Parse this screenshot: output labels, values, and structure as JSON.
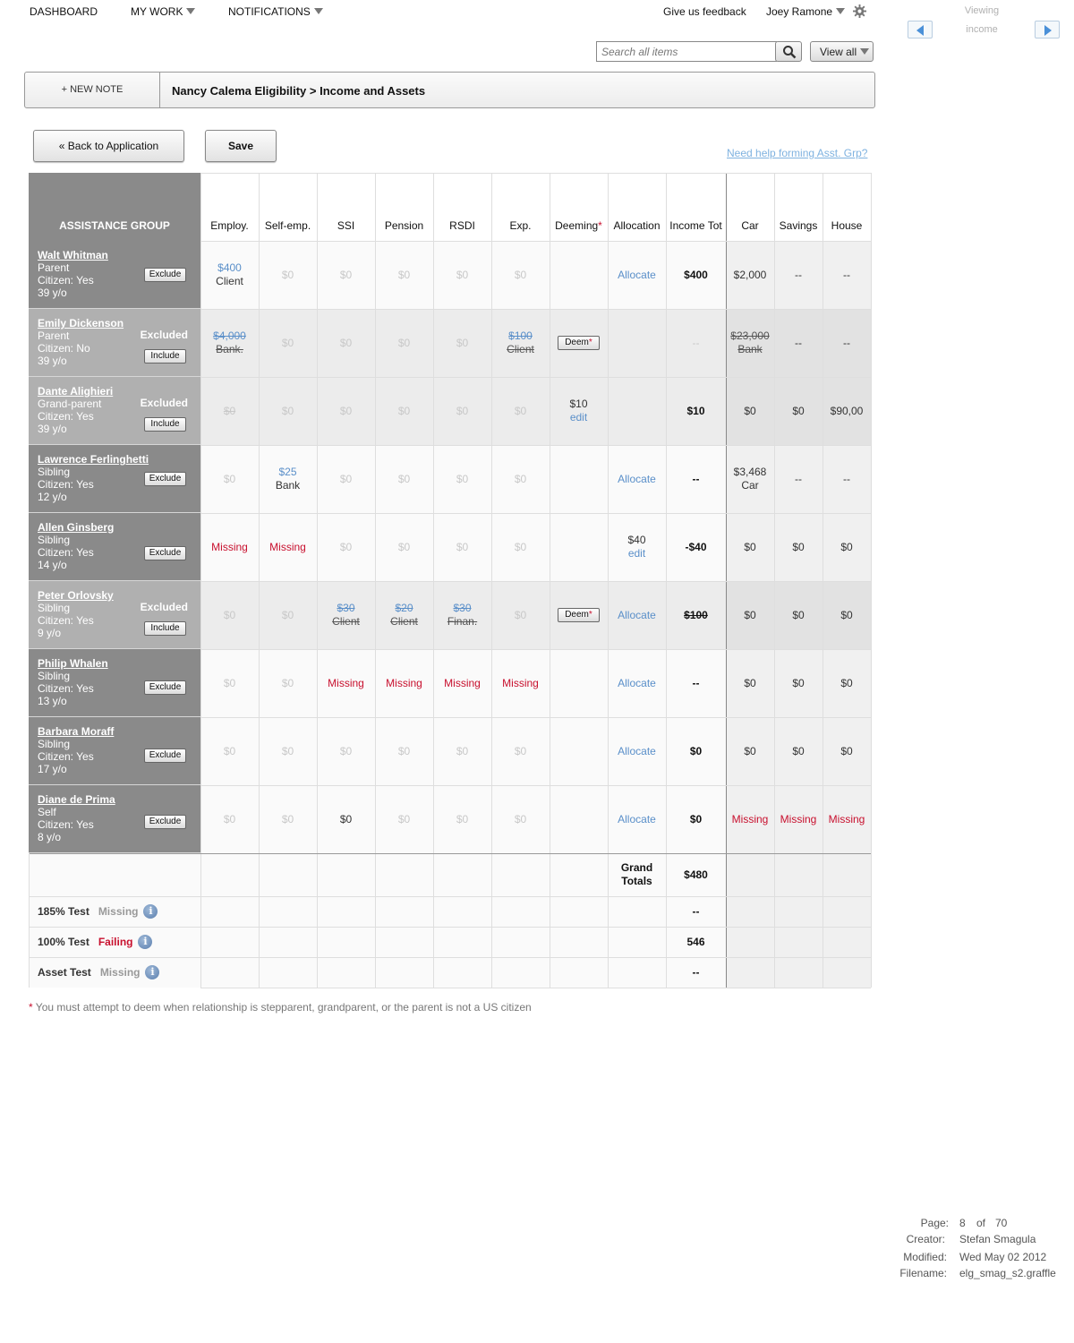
{
  "nav": {
    "dashboard": "DASHBOARD",
    "my_work": "MY WORK",
    "notifications": "NOTIFICATIONS",
    "feedback": "Give us feedback",
    "user": "Joey Ramone"
  },
  "viewer": {
    "label": "Viewing",
    "value": "income"
  },
  "search": {
    "placeholder": "Search all items",
    "view_all": "View all"
  },
  "breadcrumb": {
    "new_note": "+ NEW NOTE",
    "path": "Nancy Calema Eligibility > Income and Assets"
  },
  "actions": {
    "back": "« Back to Application",
    "save": "Save",
    "help": "Need help forming Asst. Grp?"
  },
  "table": {
    "group_header": "ASSISTANCE GROUP",
    "columns": [
      {
        "label": "Employ.",
        "star": ""
      },
      {
        "label": "Self-emp.",
        "star": ""
      },
      {
        "label": "SSI",
        "star": ""
      },
      {
        "label": "Pension",
        "star": ""
      },
      {
        "label": "RSDI",
        "star": ""
      },
      {
        "label": "Exp.",
        "star": ""
      },
      {
        "label": "Deeming",
        "star": "*"
      },
      {
        "label": "Allocation",
        "star": ""
      },
      {
        "label": "Income Tot",
        "star": ""
      },
      {
        "label": "Car",
        "star": ""
      },
      {
        "label": "Savings",
        "star": ""
      },
      {
        "label": "House",
        "star": ""
      }
    ],
    "rows": [
      {
        "name": "Walt Whitman",
        "relation": "Parent",
        "citizen": "Citizen: Yes",
        "age": "39 y/o",
        "excluded": "",
        "button": "Exclude",
        "cells": [
          {
            "t": "$400",
            "s": "link",
            "t2": "Client",
            "s2": "dark"
          },
          {
            "t": "$0",
            "s": "g"
          },
          {
            "t": "$0",
            "s": "g"
          },
          {
            "t": "$0",
            "s": "g"
          },
          {
            "t": "$0",
            "s": "g"
          },
          {
            "t": "$0",
            "s": "g"
          },
          {
            "t": "",
            "s": ""
          },
          {
            "t": "Allocate",
            "s": "link"
          },
          {
            "t": "$400",
            "s": "bold"
          },
          {
            "t": "$2,000",
            "s": "dark"
          },
          {
            "t": "--",
            "s": "dark"
          },
          {
            "t": "--",
            "s": "dark"
          }
        ]
      },
      {
        "name": "Emily Dickenson",
        "relation": "Parent",
        "citizen": "Citizen: No",
        "age": "39 y/o",
        "excluded": "Excluded",
        "button": "Include",
        "cells": [
          {
            "t": "$4,000",
            "s": "strike-blue",
            "t2": "Bank.",
            "s2": "strike-dark"
          },
          {
            "t": "$0",
            "s": "g"
          },
          {
            "t": "$0",
            "s": "g"
          },
          {
            "t": "$0",
            "s": "g"
          },
          {
            "t": "$0",
            "s": "g"
          },
          {
            "t": "$100",
            "s": "strike-blue",
            "t2": "Client",
            "s2": "strike-dark"
          },
          {
            "t": "Deem",
            "s": "deem"
          },
          {
            "t": "",
            "s": ""
          },
          {
            "t": "--",
            "s": "g"
          },
          {
            "t": "$23,000",
            "s": "strike-dark",
            "t2": "Bank",
            "s2": "strike-dark"
          },
          {
            "t": "--",
            "s": "dark"
          },
          {
            "t": "--",
            "s": "dark"
          }
        ]
      },
      {
        "name": "Dante Alighieri",
        "relation": "Grand-parent",
        "citizen": "Citizen: Yes",
        "age": "39 y/o",
        "excluded": "Excluded",
        "button": "Include",
        "cells": [
          {
            "t": "$0",
            "s": "g strike"
          },
          {
            "t": "$0",
            "s": "g"
          },
          {
            "t": "$0",
            "s": "g"
          },
          {
            "t": "$0",
            "s": "g"
          },
          {
            "t": "$0",
            "s": "g"
          },
          {
            "t": "$0",
            "s": "g"
          },
          {
            "t": "$10",
            "s": "dark",
            "t2": "edit",
            "s2": "link"
          },
          {
            "t": "",
            "s": ""
          },
          {
            "t": "$10",
            "s": "bold"
          },
          {
            "t": "$0",
            "s": "dark"
          },
          {
            "t": "$0",
            "s": "dark"
          },
          {
            "t": "$90,00",
            "s": "dark"
          }
        ]
      },
      {
        "name": "Lawrence Ferlinghetti",
        "relation": "Sibling",
        "citizen": "Citizen: Yes",
        "age": "12 y/o",
        "excluded": "",
        "button": "Exclude",
        "cells": [
          {
            "t": "$0",
            "s": "g"
          },
          {
            "t": "$25",
            "s": "link",
            "t2": "Bank",
            "s2": "dark"
          },
          {
            "t": "$0",
            "s": "g"
          },
          {
            "t": "$0",
            "s": "g"
          },
          {
            "t": "$0",
            "s": "g"
          },
          {
            "t": "$0",
            "s": "g"
          },
          {
            "t": "",
            "s": ""
          },
          {
            "t": "Allocate",
            "s": "link"
          },
          {
            "t": "--",
            "s": "bold"
          },
          {
            "t": "$3,468",
            "s": "dark",
            "t2": "Car",
            "s2": "dark"
          },
          {
            "t": "--",
            "s": "dark"
          },
          {
            "t": "--",
            "s": "dark"
          }
        ]
      },
      {
        "name": "Allen Ginsberg",
        "relation": "Sibling",
        "citizen": "Citizen: Yes",
        "age": "14 y/o",
        "excluded": "",
        "button": "Exclude",
        "cells": [
          {
            "t": "Missing",
            "s": "miss"
          },
          {
            "t": "Missing",
            "s": "miss"
          },
          {
            "t": "$0",
            "s": "g"
          },
          {
            "t": "$0",
            "s": "g"
          },
          {
            "t": "$0",
            "s": "g"
          },
          {
            "t": "$0",
            "s": "g"
          },
          {
            "t": "",
            "s": ""
          },
          {
            "t": "$40",
            "s": "dark",
            "t2": "edit",
            "s2": "link"
          },
          {
            "t": "-$40",
            "s": "bold"
          },
          {
            "t": "$0",
            "s": "dark"
          },
          {
            "t": "$0",
            "s": "dark"
          },
          {
            "t": "$0",
            "s": "dark"
          }
        ]
      },
      {
        "name": "Peter Orlovsky",
        "relation": "Sibling",
        "citizen": "Citizen: Yes",
        "age": "9 y/o",
        "excluded": "Excluded",
        "button": "Include",
        "cells": [
          {
            "t": "$0",
            "s": "g"
          },
          {
            "t": "$0",
            "s": "g"
          },
          {
            "t": "$30",
            "s": "strike-blue",
            "t2": "Client",
            "s2": "strike-dark"
          },
          {
            "t": "$20",
            "s": "strike-blue",
            "t2": "Client",
            "s2": "strike-dark"
          },
          {
            "t": "$30",
            "s": "strike-blue",
            "t2": "Finan.",
            "s2": "strike-dark"
          },
          {
            "t": "$0",
            "s": "g"
          },
          {
            "t": "Deem",
            "s": "deem"
          },
          {
            "t": "Allocate",
            "s": "link"
          },
          {
            "t": "$100",
            "s": "bold strike"
          },
          {
            "t": "$0",
            "s": "dark"
          },
          {
            "t": "$0",
            "s": "dark"
          },
          {
            "t": "$0",
            "s": "dark"
          }
        ]
      },
      {
        "name": "Philip Whalen",
        "relation": "Sibling",
        "citizen": "Citizen: Yes",
        "age": "13 y/o",
        "excluded": "",
        "button": "Exclude",
        "cells": [
          {
            "t": "$0",
            "s": "g"
          },
          {
            "t": "$0",
            "s": "g"
          },
          {
            "t": "Missing",
            "s": "miss"
          },
          {
            "t": "Missing",
            "s": "miss"
          },
          {
            "t": "Missing",
            "s": "miss"
          },
          {
            "t": "Missing",
            "s": "miss"
          },
          {
            "t": "",
            "s": ""
          },
          {
            "t": "Allocate",
            "s": "link"
          },
          {
            "t": "--",
            "s": "bold"
          },
          {
            "t": "$0",
            "s": "dark"
          },
          {
            "t": "$0",
            "s": "dark"
          },
          {
            "t": "$0",
            "s": "dark"
          }
        ]
      },
      {
        "name": "Barbara Moraff",
        "relation": "Sibling",
        "citizen": "Citizen: Yes",
        "age": "17 y/o",
        "excluded": "",
        "button": "Exclude",
        "cells": [
          {
            "t": "$0",
            "s": "g"
          },
          {
            "t": "$0",
            "s": "g"
          },
          {
            "t": "$0",
            "s": "g"
          },
          {
            "t": "$0",
            "s": "g"
          },
          {
            "t": "$0",
            "s": "g"
          },
          {
            "t": "$0",
            "s": "g"
          },
          {
            "t": "",
            "s": ""
          },
          {
            "t": "Allocate",
            "s": "link"
          },
          {
            "t": "$0",
            "s": "bold"
          },
          {
            "t": "$0",
            "s": "dark"
          },
          {
            "t": "$0",
            "s": "dark"
          },
          {
            "t": "$0",
            "s": "dark"
          }
        ]
      },
      {
        "name": "Diane de Prima",
        "relation": "Self",
        "citizen": "Citizen: Yes",
        "age": "8 y/o",
        "excluded": "",
        "button": "Exclude",
        "cells": [
          {
            "t": "$0",
            "s": "g"
          },
          {
            "t": "$0",
            "s": "g"
          },
          {
            "t": "$0",
            "s": "dark"
          },
          {
            "t": "$0",
            "s": "g"
          },
          {
            "t": "$0",
            "s": "g"
          },
          {
            "t": "$0",
            "s": "g"
          },
          {
            "t": "",
            "s": ""
          },
          {
            "t": "Allocate",
            "s": "link"
          },
          {
            "t": "$0",
            "s": "bold"
          },
          {
            "t": "Missing",
            "s": "miss"
          },
          {
            "t": "Missing",
            "s": "miss"
          },
          {
            "t": "Missing",
            "s": "miss"
          }
        ]
      }
    ],
    "grand_totals": {
      "label": "Grand Totals",
      "value": "$480"
    },
    "tests": [
      {
        "label": "185% Test",
        "status": "Missing",
        "status_style": "missing",
        "value": "--"
      },
      {
        "label": "100% Test",
        "status": "Failing",
        "status_style": "failing",
        "value": "546"
      },
      {
        "label": "Asset Test",
        "status": "Missing",
        "status_style": "missing",
        "value": "--"
      }
    ]
  },
  "footnote": {
    "star": "*",
    "text": " You must attempt to deem when relationship is stepparent, grandparent, or the parent is not a US citizen"
  },
  "page_info": {
    "page_label": "Page:",
    "page": "8",
    "of": "of",
    "total": "70",
    "creator_label": "Creator:",
    "creator": "Stefan Smagula",
    "modified_label": "Modified:",
    "modified": "Wed May 02 2012",
    "filename_label": "Filename:",
    "filename": "elg_smag_s2.graffle"
  },
  "colors": {
    "member_bg": "#8a8a8a",
    "member_excluded_bg": "#b0b0b0",
    "missing": "#c8102e",
    "link": "#5a8fc9"
  }
}
